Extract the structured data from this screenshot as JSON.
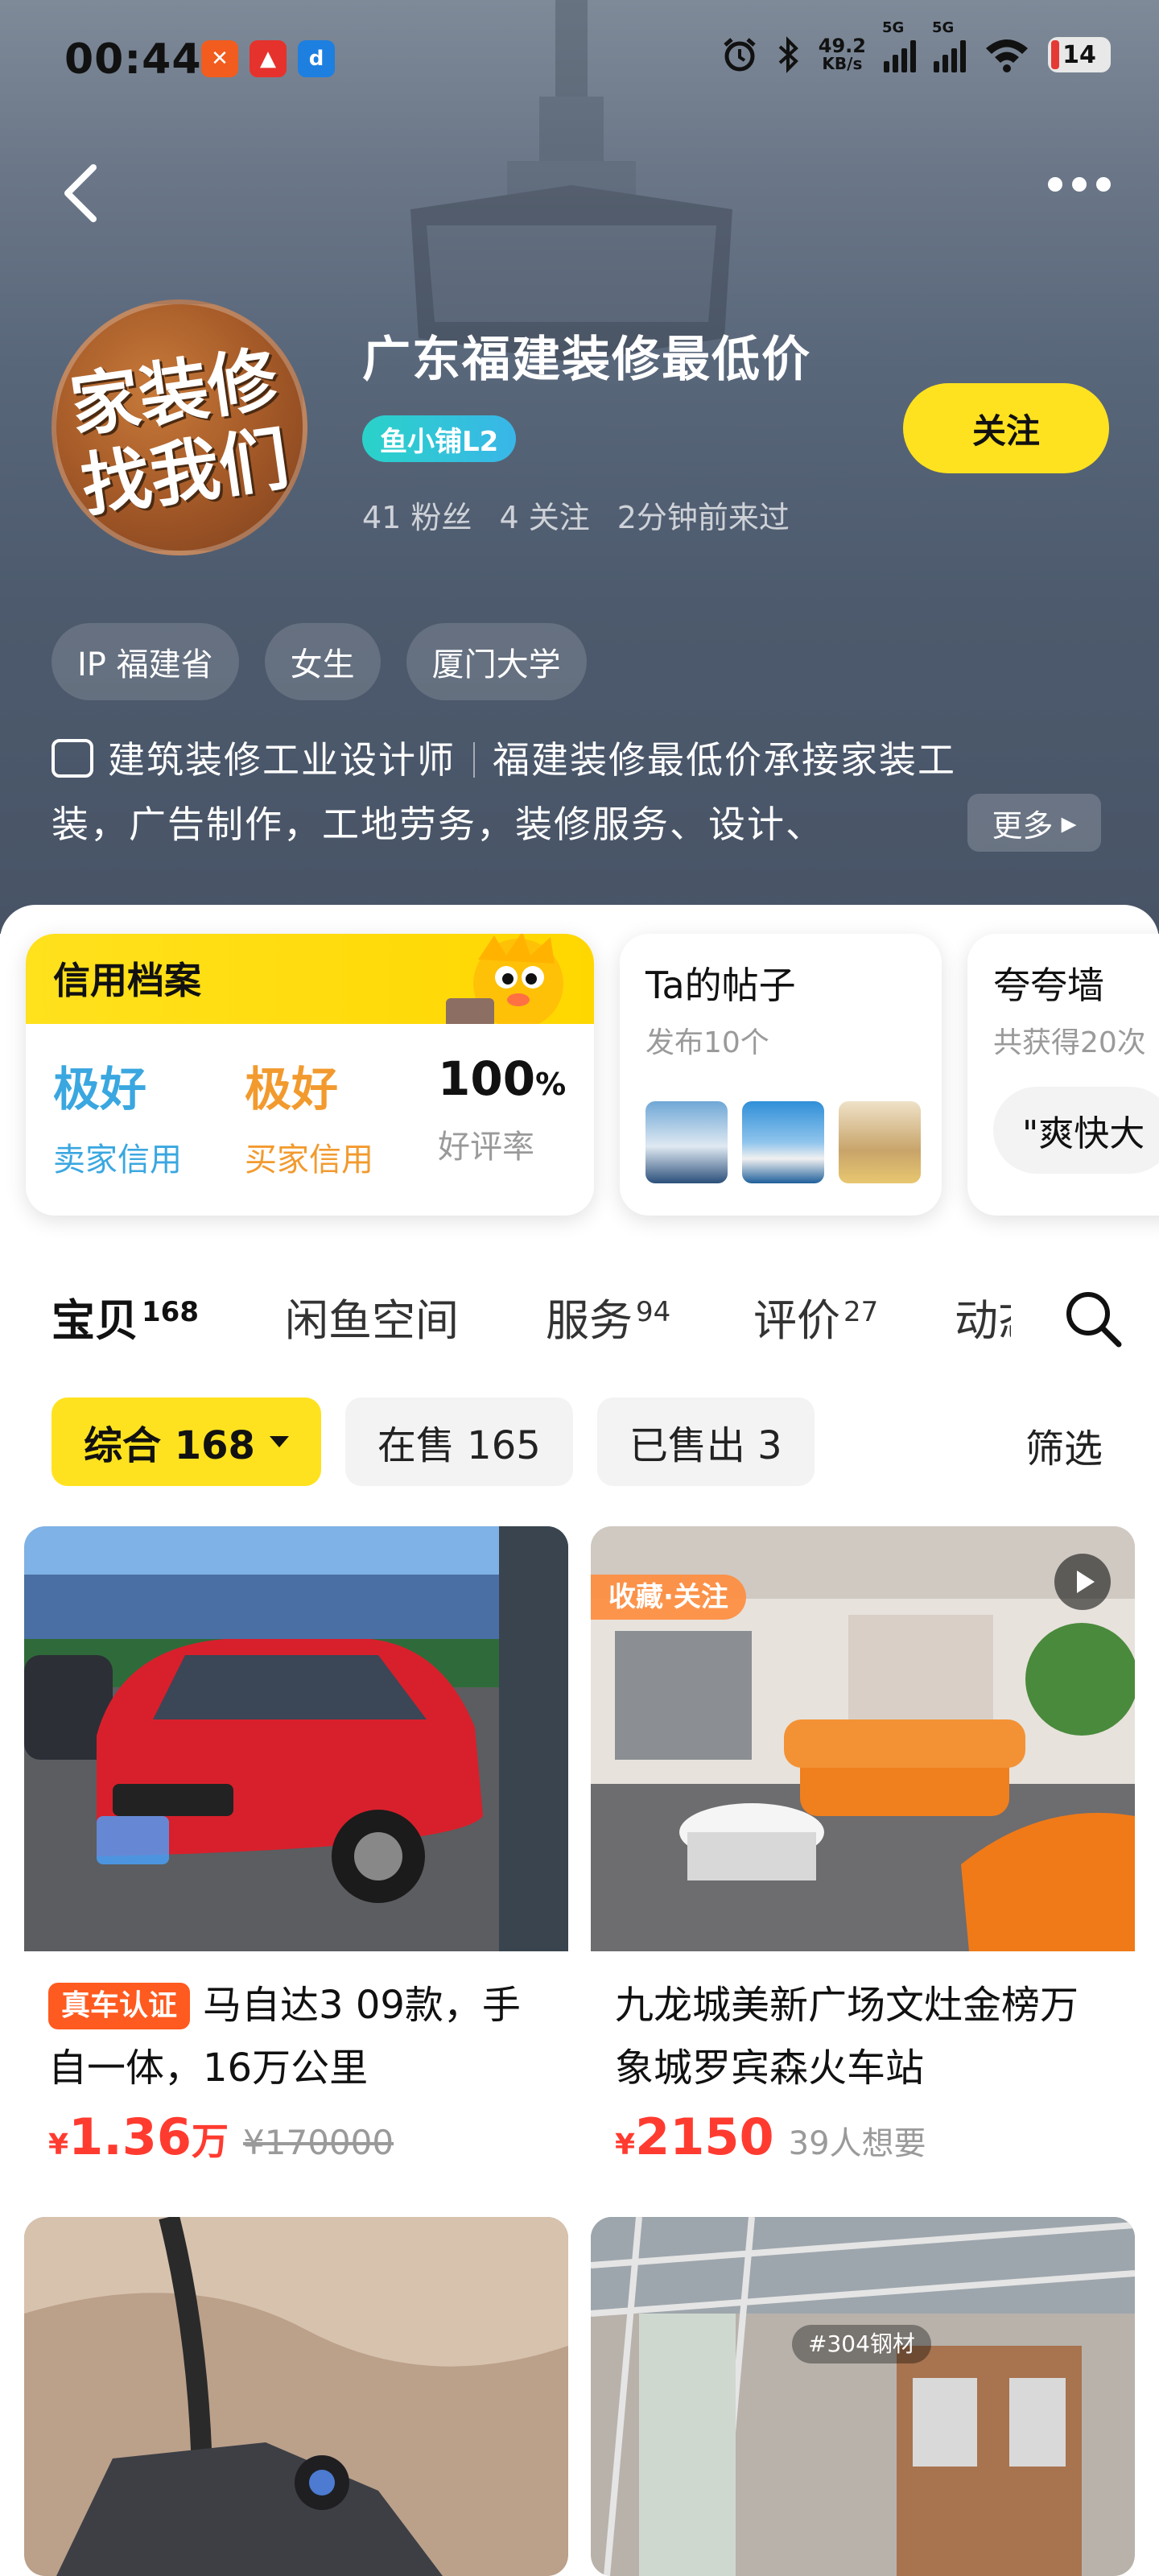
{
  "status_bar": {
    "time": "00:44",
    "net_speed_value": "49.2",
    "net_speed_unit": "KB/s",
    "signal1_label": "5G",
    "signal2_label": "5G",
    "battery": "14"
  },
  "profile": {
    "avatar_text": "家装修找我们",
    "name": "广东福建装修最低价",
    "level_badge": "鱼小铺L2",
    "followers": "41 粉丝",
    "following": "4 关注",
    "last_seen": "2分钟前来过",
    "follow_label": "关注",
    "tags": [
      "IP 福建省",
      "女生",
      "厦门大学"
    ],
    "bio_title": "建筑装修工业设计师",
    "bio_line1": "福建装修最低价承接家装工",
    "bio_line2": "装，广告制作，工地劳务，装修服务、设计、",
    "more_label": "更多"
  },
  "credit": {
    "title": "信用档案",
    "seller_value": "极好",
    "seller_label": "卖家信用",
    "buyer_value": "极好",
    "buyer_label": "买家信用",
    "rate_value": "100",
    "rate_unit": "%",
    "rate_label": "好评率"
  },
  "posts": {
    "title": "Ta的帖子",
    "subtitle": "发布10个"
  },
  "praise": {
    "title": "夸夸墙",
    "subtitle": "共获得20次",
    "quote": "\"爽快大"
  },
  "tabs": [
    {
      "label": "宝贝",
      "count": "168"
    },
    {
      "label": "闲鱼空间",
      "count": ""
    },
    {
      "label": "服务",
      "count": "94"
    },
    {
      "label": "评价",
      "count": "27"
    },
    {
      "label": "动态",
      "count": ""
    }
  ],
  "filters": {
    "all": "综合 168",
    "on_sale": "在售 165",
    "sold": "已售出 3",
    "filter_label": "筛选"
  },
  "items": [
    {
      "badge": "真车认证",
      "title": "马自达3 09款，手自一体，16万公里",
      "currency": "¥",
      "price": "1.36",
      "unit": "万",
      "original_price": "¥170000"
    },
    {
      "image_tag": "收藏·关注",
      "title": "九龙城美新广场文灶金榜万象城罗宾森火车站",
      "currency": "¥",
      "price": "2150",
      "wants": "39人想要"
    },
    {},
    {
      "image_tag": "#304钢材"
    }
  ],
  "colors": {
    "accent_yellow": "#ffe21f",
    "price_red": "#ff3b30",
    "seller_blue": "#3aa7e0",
    "buyer_orange": "#f29a2e"
  }
}
